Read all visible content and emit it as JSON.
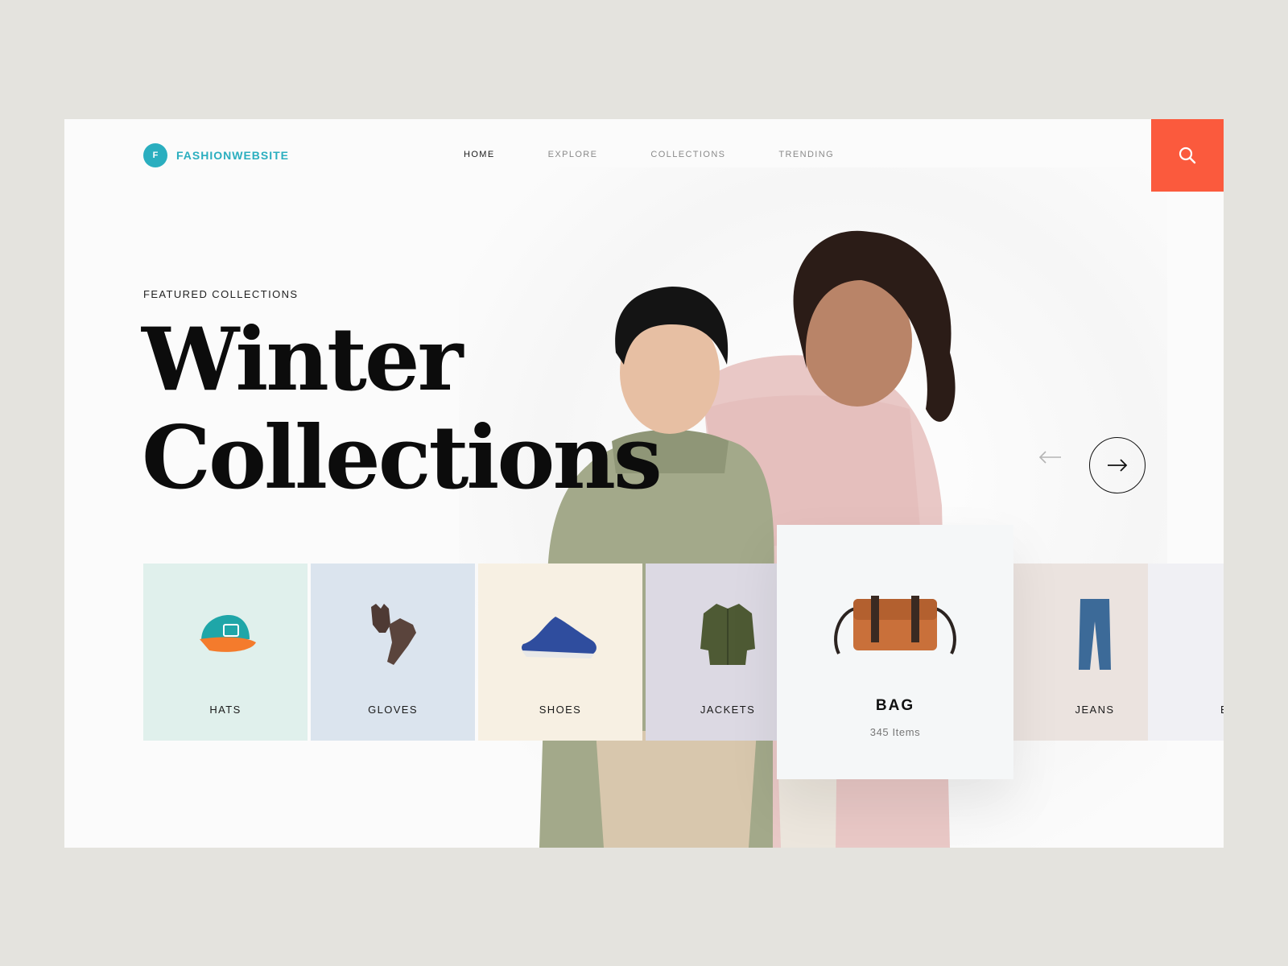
{
  "brand": {
    "initial": "F",
    "name": "FASHIONWEBSITE"
  },
  "nav": [
    {
      "label": "HOME",
      "active": true
    },
    {
      "label": "EXPLORE",
      "active": false
    },
    {
      "label": "COLLECTIONS",
      "active": false
    },
    {
      "label": "TRENDING",
      "active": false
    }
  ],
  "search": {
    "icon": "search-icon"
  },
  "hero": {
    "eyebrow": "FEATURED COLLECTIONS",
    "line1": "Winter",
    "line2": "Collections"
  },
  "carousel": {
    "prev_icon": "arrow-left-icon",
    "next_icon": "arrow-right-icon"
  },
  "categories": [
    {
      "label": "HATS",
      "bg": "#e0f0ec",
      "icon": "cap-icon"
    },
    {
      "label": "GLOVES",
      "bg": "#dbe4ee",
      "icon": "gloves-icon"
    },
    {
      "label": "SHOES",
      "bg": "#f7f0e3",
      "icon": "sneaker-icon"
    },
    {
      "label": "JACKETS",
      "bg": "#dcd9e3",
      "icon": "jacket-icon"
    },
    {
      "label": "BAG",
      "count": "345 Items",
      "bg": "#f5f7f8",
      "icon": "bag-icon",
      "featured": true
    },
    {
      "label": "JEANS",
      "bg": "#ebe3df",
      "icon": "jeans-icon"
    },
    {
      "label": "E",
      "bg": "#f0f0f4",
      "icon": "sunglasses-icon"
    }
  ],
  "colors": {
    "accent": "#fb5a3d",
    "brand": "#2aaebf"
  }
}
